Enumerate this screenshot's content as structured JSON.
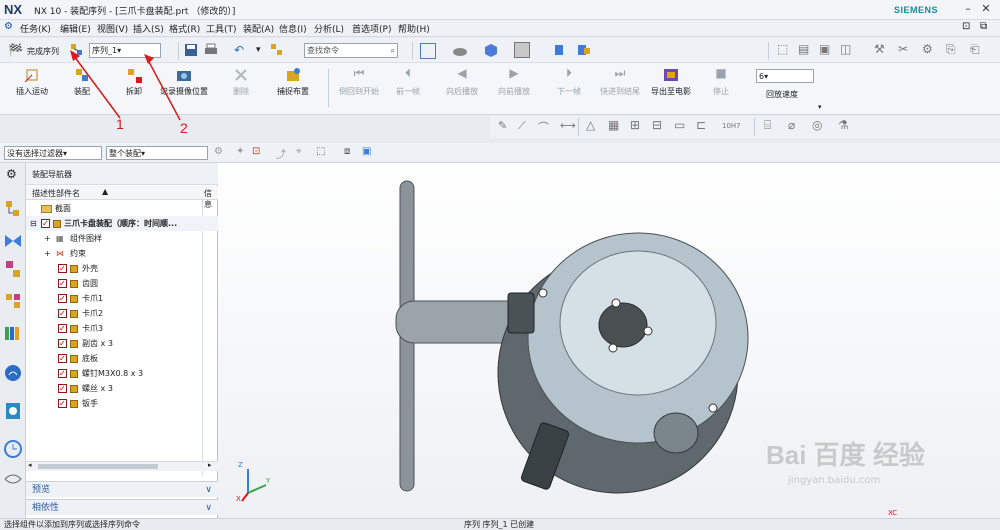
{
  "title": {
    "logo": "NX",
    "text": "NX 10 - 装配序列 - [三爪卡盘装配.prt （修改的）]",
    "brand": "SIEMENS"
  },
  "menu": [
    "任务(K)",
    "编辑(E)",
    "视图(V)",
    "插入(S)",
    "格式(R)",
    "工具(T)",
    "装配(A)",
    "信息(I)",
    "分析(L)",
    "首选项(P)",
    "帮助(H)"
  ],
  "toolbar1": {
    "finish": "完成序列",
    "sequence": "序列_1",
    "search_placeholder": "查找命令"
  },
  "ribbon": {
    "buttons": [
      {
        "label": "插入运动",
        "disabled": false
      },
      {
        "label": "装配",
        "disabled": false
      },
      {
        "label": "拆卸",
        "disabled": false
      },
      {
        "label": "记录摄像位置",
        "disabled": false
      },
      {
        "label": "删除",
        "disabled": true
      },
      {
        "label": "捕捉布置",
        "disabled": false
      },
      {
        "label": "倒回到开始",
        "disabled": true
      },
      {
        "label": "前一帧",
        "disabled": true
      },
      {
        "label": "向后播放",
        "disabled": true
      },
      {
        "label": "向前播放",
        "disabled": true
      },
      {
        "label": "下一帧",
        "disabled": true
      },
      {
        "label": "快进到结尾",
        "disabled": true
      },
      {
        "label": "导出至电影",
        "disabled": false
      },
      {
        "label": "停止",
        "disabled": true
      }
    ],
    "speed_value": "6",
    "speed_label": "回放速度"
  },
  "filter": {
    "select_filter": "没有选择过滤器",
    "scope": "整个装配"
  },
  "navigator": {
    "title": "装配导航器",
    "col1": "描述性部件名",
    "col2": "信息",
    "rows": [
      {
        "label": "截面",
        "indent": 1,
        "kind": "folder"
      },
      {
        "label": "三爪卡盘装配（顺序：时间顺...",
        "indent": 1,
        "kind": "root"
      },
      {
        "label": "组件图样",
        "indent": 2,
        "kind": "sub"
      },
      {
        "label": "约束",
        "indent": 2,
        "kind": "sub"
      },
      {
        "label": "外壳",
        "indent": 2,
        "kind": "part"
      },
      {
        "label": "齿圆",
        "indent": 2,
        "kind": "part"
      },
      {
        "label": "卡爪1",
        "indent": 2,
        "kind": "part"
      },
      {
        "label": "卡爪2",
        "indent": 2,
        "kind": "part"
      },
      {
        "label": "卡爪3",
        "indent": 2,
        "kind": "part"
      },
      {
        "label": "副齿 x 3",
        "indent": 2,
        "kind": "part"
      },
      {
        "label": "底板",
        "indent": 2,
        "kind": "part"
      },
      {
        "label": "螺钉M3X0.8 x 3",
        "indent": 2,
        "kind": "part"
      },
      {
        "label": "螺丝 x 3",
        "indent": 2,
        "kind": "part"
      },
      {
        "label": "钣手",
        "indent": 2,
        "kind": "part"
      }
    ],
    "preview": "预览",
    "dependency": "相依性"
  },
  "annotations": {
    "a1": "1",
    "a2": "2"
  },
  "status": {
    "left": "选择组件以添加到序列或选择序列命令",
    "center": "序列 序列_1 已创建"
  },
  "axis": {
    "z": "Z",
    "y": "Y",
    "x": "X",
    "xc": "XC"
  },
  "watermark": {
    "brand": "Bai  百度 经验",
    "url": "jingyan.baidu.com"
  }
}
